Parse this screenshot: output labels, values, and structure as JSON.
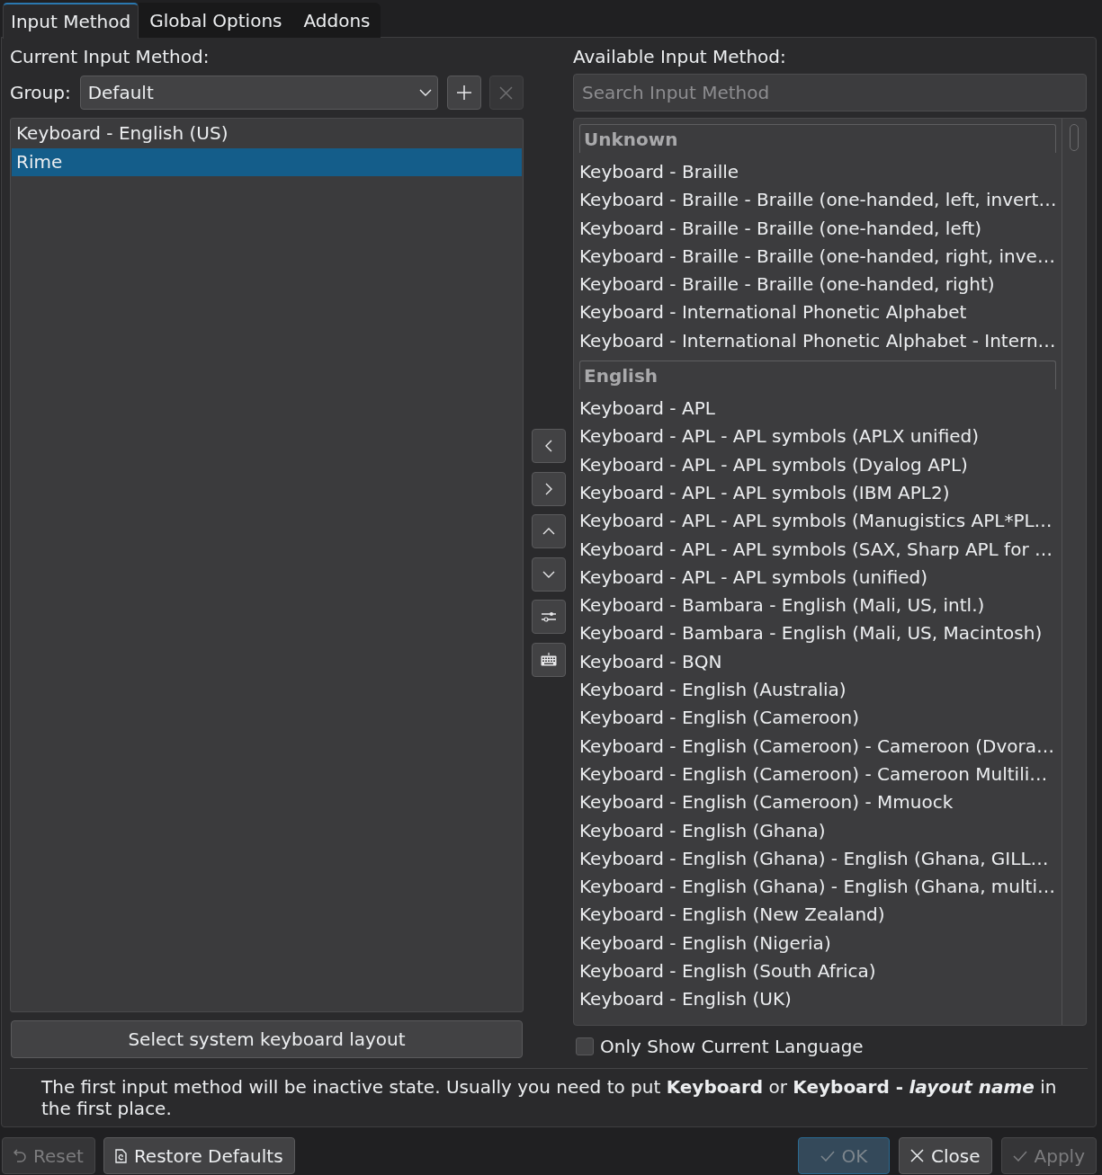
{
  "tabs": [
    {
      "label": "Input Method",
      "selected": true
    },
    {
      "label": "Global Options",
      "selected": false
    },
    {
      "label": "Addons",
      "selected": false
    }
  ],
  "current_input_method": {
    "label": "Current Input Method:",
    "group": {
      "label": "Group:",
      "value": "Default",
      "buttons": [
        {
          "kind": "add",
          "disabled": false
        },
        {
          "kind": "remove",
          "disabled": true
        }
      ]
    },
    "items": [
      {
        "label": "Keyboard - English (US)",
        "selected": false
      },
      {
        "label": "Rime",
        "selected": true
      }
    ],
    "layout_button": "Select system keyboard layout"
  },
  "available_input_method": {
    "label": "Available Input Method:",
    "search": {
      "placeholder": "Search Input Method"
    },
    "items": [
      {
        "kind": "header",
        "label": "Unknown"
      },
      {
        "kind": "item",
        "label": "Keyboard - Braille",
        "selected": false
      },
      {
        "kind": "item",
        "label": "Keyboard - Braille - Braille (one-handed, left, invert…",
        "selected": false
      },
      {
        "kind": "item",
        "label": "Keyboard - Braille - Braille (one-handed, left)",
        "selected": false
      },
      {
        "kind": "item",
        "label": "Keyboard - Braille - Braille (one-handed, right, inve…",
        "selected": false
      },
      {
        "kind": "item",
        "label": "Keyboard - Braille - Braille (one-handed, right)",
        "selected": false
      },
      {
        "kind": "item",
        "label": "Keyboard - International Phonetic Alphabet",
        "selected": false
      },
      {
        "kind": "item",
        "label": "Keyboard - International Phonetic Alphabet - Intern…",
        "selected": false
      },
      {
        "kind": "header",
        "label": "English"
      },
      {
        "kind": "item",
        "label": "Keyboard - APL",
        "selected": false
      },
      {
        "kind": "item",
        "label": "Keyboard - APL - APL symbols (APLX unified)",
        "selected": false
      },
      {
        "kind": "item",
        "label": "Keyboard - APL - APL symbols (Dyalog APL)",
        "selected": false
      },
      {
        "kind": "item",
        "label": "Keyboard - APL - APL symbols (IBM APL2)",
        "selected": false
      },
      {
        "kind": "item",
        "label": "Keyboard - APL - APL symbols (Manugistics APL*PL…",
        "selected": false
      },
      {
        "kind": "item",
        "label": "Keyboard - APL - APL symbols (SAX, Sharp APL for …",
        "selected": false
      },
      {
        "kind": "item",
        "label": "Keyboard - APL - APL symbols (unified)",
        "selected": false
      },
      {
        "kind": "item",
        "label": "Keyboard - Bambara - English (Mali, US, intl.)",
        "selected": false
      },
      {
        "kind": "item",
        "label": "Keyboard - Bambara - English (Mali, US, Macintosh)",
        "selected": false
      },
      {
        "kind": "item",
        "label": "Keyboard - BQN",
        "selected": false
      },
      {
        "kind": "item",
        "label": "Keyboard - English (Australia)",
        "selected": false
      },
      {
        "kind": "item",
        "label": "Keyboard - English (Cameroon)",
        "selected": false
      },
      {
        "kind": "item",
        "label": "Keyboard - English (Cameroon) - Cameroon (Dvora…",
        "selected": false
      },
      {
        "kind": "item",
        "label": "Keyboard - English (Cameroon) - Cameroon Multili…",
        "selected": false
      },
      {
        "kind": "item",
        "label": "Keyboard - English (Cameroon) - Mmuock",
        "selected": false
      },
      {
        "kind": "item",
        "label": "Keyboard - English (Ghana)",
        "selected": false
      },
      {
        "kind": "item",
        "label": "Keyboard - English (Ghana) - English (Ghana, GILL…",
        "selected": false
      },
      {
        "kind": "item",
        "label": "Keyboard - English (Ghana) - English (Ghana, multi…",
        "selected": false
      },
      {
        "kind": "item",
        "label": "Keyboard - English (New Zealand)",
        "selected": false
      },
      {
        "kind": "item",
        "label": "Keyboard - English (Nigeria)",
        "selected": false
      },
      {
        "kind": "item",
        "label": "Keyboard - English (South Africa)",
        "selected": false
      },
      {
        "kind": "item",
        "label": "Keyboard - English (UK)",
        "selected": false
      }
    ],
    "only_current_language": {
      "label": "Only Show Current Language",
      "checked": false
    }
  },
  "info": "The first input method will be inactive state. Usually you need to put **Keyboard** or **Keyboard -** *layout name* in the first place.",
  "footer": {
    "left": [
      {
        "kind": "reset",
        "label": "Reset",
        "disabled": true
      },
      {
        "kind": "restore",
        "label": "Restore Defaults",
        "disabled": false
      }
    ],
    "right": [
      {
        "kind": "ok",
        "label": "OK",
        "disabled": true,
        "default": true
      },
      {
        "kind": "close",
        "label": "Close",
        "disabled": false,
        "default": false
      },
      {
        "kind": "apply",
        "label": "Apply",
        "disabled": true,
        "default": false
      }
    ]
  }
}
